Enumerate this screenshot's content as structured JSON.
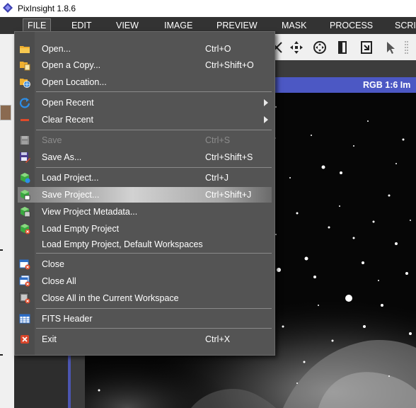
{
  "window": {
    "title": "PixInsight 1.8.6"
  },
  "menubar": {
    "items": [
      "FILE",
      "EDIT",
      "VIEW",
      "IMAGE",
      "PREVIEW",
      "MASK",
      "PROCESS",
      "SCRI"
    ]
  },
  "image": {
    "header": "RGB 1:6 Im"
  },
  "colors": {
    "menu_bg": "#545454",
    "highlight": "#d2d2d2",
    "image_bar": "#4c58c4"
  },
  "file_menu": {
    "items": [
      {
        "label": "Open...",
        "shortcut": "Ctrl+O",
        "icon": "folder-open-icon"
      },
      {
        "label": "Open a Copy...",
        "shortcut": "Ctrl+Shift+O",
        "icon": "folder-copy-icon"
      },
      {
        "label": "Open Location...",
        "shortcut": "",
        "icon": "globe-location-icon"
      },
      {
        "label": "Open Recent",
        "shortcut": "",
        "icon": "reload-icon",
        "submenu": true
      },
      {
        "label": "Clear Recent",
        "shortcut": "",
        "icon": "clear-dash-icon",
        "submenu": true
      },
      {
        "label": "Save",
        "shortcut": "Ctrl+S",
        "icon": "save-icon",
        "disabled": true
      },
      {
        "label": "Save As...",
        "shortcut": "Ctrl+Shift+S",
        "icon": "save-as-icon"
      },
      {
        "label": "Load Project...",
        "shortcut": "Ctrl+J",
        "icon": "load-project-icon"
      },
      {
        "label": "Save Project...",
        "shortcut": "Ctrl+Shift+J",
        "icon": "save-project-icon",
        "highlighted": true
      },
      {
        "label": "View Project Metadata...",
        "shortcut": "",
        "icon": "project-metadata-icon"
      },
      {
        "label": "Load Empty Project",
        "shortcut": "",
        "icon": "empty-project-icon"
      },
      {
        "label": "Load Empty Project, Default Workspaces",
        "shortcut": "",
        "icon": ""
      },
      {
        "label": "Close",
        "shortcut": "",
        "icon": "close-window-icon"
      },
      {
        "label": "Close All",
        "shortcut": "",
        "icon": "close-all-icon"
      },
      {
        "label": "Close All in the Current Workspace",
        "shortcut": "",
        "icon": "close-workspace-icon"
      },
      {
        "label": "FITS Header",
        "shortcut": "",
        "icon": "fits-header-table-icon"
      },
      {
        "label": "Exit",
        "shortcut": "Ctrl+X",
        "icon": "exit-icon"
      }
    ]
  }
}
